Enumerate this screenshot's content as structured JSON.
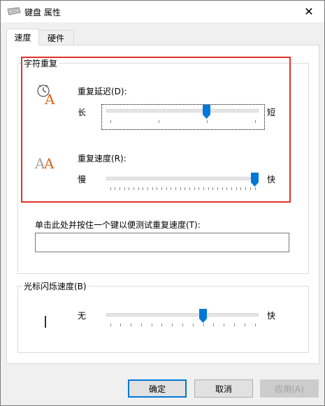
{
  "window": {
    "title": "键盘 属性",
    "close_glyph": "✕"
  },
  "tabs": [
    {
      "label": "速度",
      "active": true
    },
    {
      "label": "硬件",
      "active": false
    }
  ],
  "char_repeat": {
    "group_label": "字符重复",
    "delay": {
      "label": "重复延迟(D):",
      "min_label": "长",
      "max_label": "短",
      "value": 2,
      "max": 3
    },
    "rate": {
      "label": "重复速度(R):",
      "min_label": "慢",
      "max_label": "快",
      "value": 31,
      "max": 31
    },
    "test_label": "单击此处并按住一个键以便测试重复速度(T):",
    "test_value": ""
  },
  "cursor_blink": {
    "group_label": "光标闪烁速度(B)",
    "min_label": "无",
    "max_label": "快",
    "value": 9,
    "max": 14
  },
  "buttons": {
    "ok": "确定",
    "cancel": "取消",
    "apply": "应用(A)"
  },
  "colors": {
    "highlight": "#e0312b",
    "thumb": "#0078d7",
    "default_button_border": "#0078d7"
  }
}
